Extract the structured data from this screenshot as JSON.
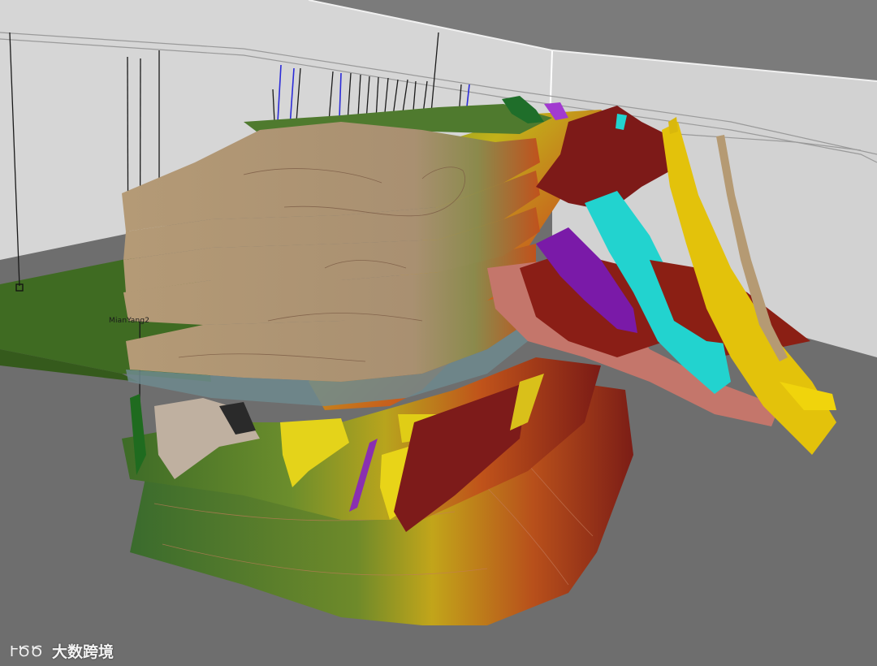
{
  "scene": {
    "well_label": "MianYang2",
    "watermark_text": "大数跨境",
    "watermark_logo_text": "ՒԾԾ"
  },
  "colors": {
    "floor": "#6e6e6e",
    "back_wall": "#d8d8d8",
    "ceiling": "#7a7a7a",
    "ground_plane": "#3f6b22",
    "tan_horizon": "#b59a73",
    "fault_cyan": "#22d3cf",
    "fault_yellow": "#e2c20a",
    "fault_purple": "#7a1aa8",
    "fault_maroon": "#7d1818",
    "fault_salmon": "#c7756a",
    "fault_tan": "#b59a73"
  }
}
